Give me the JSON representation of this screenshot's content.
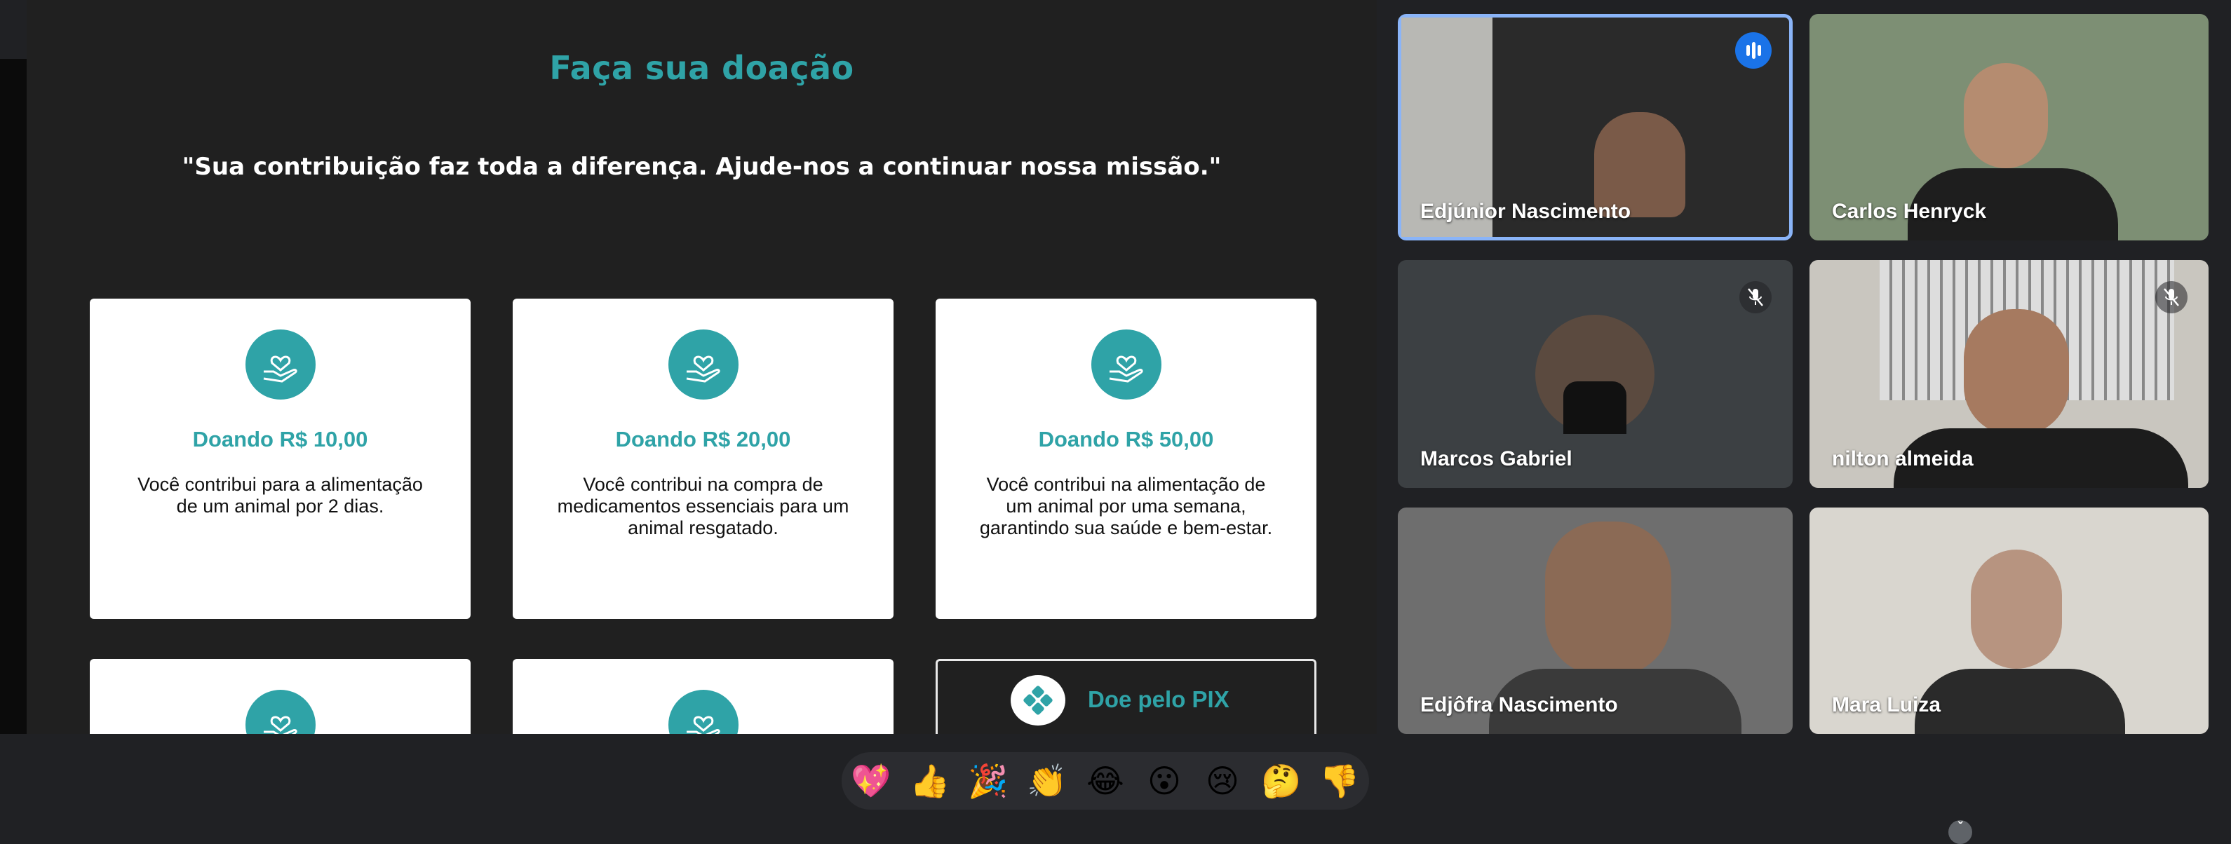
{
  "presentation": {
    "title": "Faça sua doação",
    "quote": "\"Sua contribuição faz toda a diferença. Ajude-nos a continuar nossa missão.\"",
    "cards": [
      {
        "title": "Doando R$ 10,00",
        "description": "Você contribui para a alimentação de um animal por 2 dias.",
        "icon": "heart-hand-icon"
      },
      {
        "title": "Doando R$ 20,00",
        "description": "Você contribui na compra de medicamentos essenciais para um animal resgatado.",
        "icon": "heart-hand-icon"
      },
      {
        "title": "Doando R$ 50,00",
        "description": "Você contribui na alimentação de um animal por uma semana, garantindo sua saúde e bem-estar.",
        "icon": "heart-hand-icon"
      }
    ],
    "pix": {
      "label": "Doe pelo PIX",
      "icon": "pix-icon"
    },
    "accent_color": "#2fa3a7"
  },
  "participants": [
    {
      "name": "Edjúnior Nascimento",
      "speaking": true,
      "muted": false
    },
    {
      "name": "Carlos Henryck",
      "speaking": false,
      "muted": false
    },
    {
      "name": "Marcos Gabriel",
      "speaking": false,
      "muted": true
    },
    {
      "name": "nilton almeida",
      "speaking": false,
      "muted": true
    },
    {
      "name": "Edjôfra Nascimento",
      "speaking": false,
      "muted": false
    },
    {
      "name": "Mara Luiza",
      "speaking": false,
      "muted": false
    }
  ],
  "reactions": [
    "💖",
    "👍",
    "🎉",
    "👏",
    "😂",
    "😮",
    "😢",
    "🤔",
    "👎"
  ],
  "colors": {
    "background": "#202124",
    "tile": "#3c4043",
    "active_border": "#8ab4f8"
  }
}
